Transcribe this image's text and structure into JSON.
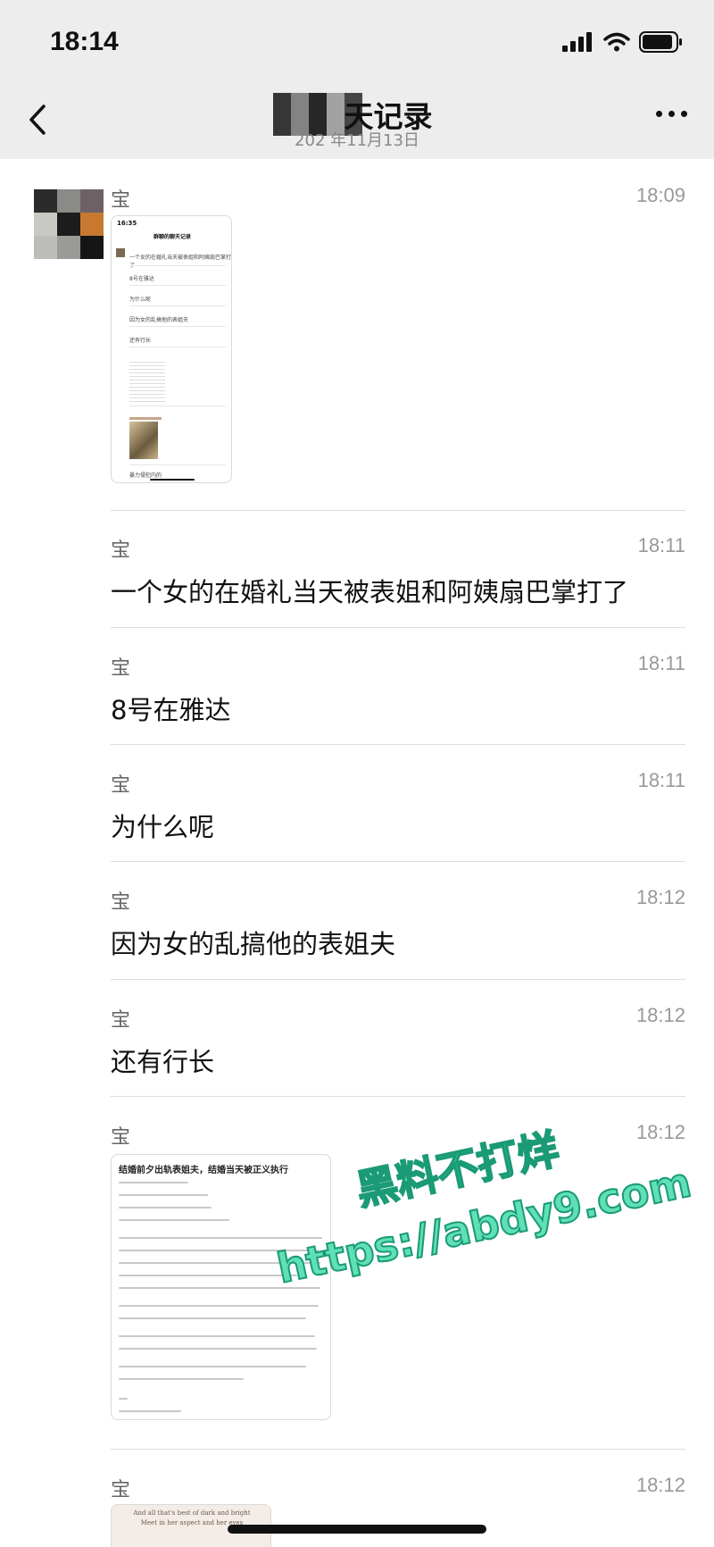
{
  "status_bar": {
    "time": "18:14"
  },
  "nav": {
    "title": "天记录",
    "subtitle": "202 年11月13日"
  },
  "messages": [
    {
      "sender": "宝",
      "time": "18:09",
      "type": "image"
    },
    {
      "sender": "宝",
      "time": "18:11",
      "text": "一个女的在婚礼当天被表姐和阿姨扇巴掌打了"
    },
    {
      "sender": "宝",
      "time": "18:11",
      "text": "8号在雅达"
    },
    {
      "sender": "宝",
      "time": "18:11",
      "text": "为什么呢"
    },
    {
      "sender": "宝",
      "time": "18:12",
      "text": "因为女的乱搞他的表姐夫"
    },
    {
      "sender": "宝",
      "time": "18:12",
      "text": "还有行长"
    },
    {
      "sender": "宝",
      "time": "18:12",
      "type": "image"
    },
    {
      "sender": "宝",
      "time": "18:12",
      "type": "image"
    }
  ],
  "thumb1": {
    "time": "16:35",
    "title": "群聊的聊天记录",
    "lines": [
      "一个女的在婚礼当天被表姐和阿姨扇巴掌打了",
      "8号在雅达",
      "为什么呢",
      "因为女的乱搞他的表姐夫",
      "还有行长",
      "暴力侵犯内的"
    ]
  },
  "thumb2": {
    "title": "结婚前夕出轨表姐夫，结婚当天被正义执行"
  },
  "thumb3": {
    "line1": "And all that's best of dark and bright",
    "line2": "Meet in her aspect and her eyes"
  },
  "watermark": {
    "line1": "黑料不打烊",
    "line2": "https://abdy9.com"
  },
  "colors": {
    "topbar_bg": "#ededed",
    "watermark_fill": "#5fe0b5",
    "watermark_stroke": "#1b9a76"
  }
}
